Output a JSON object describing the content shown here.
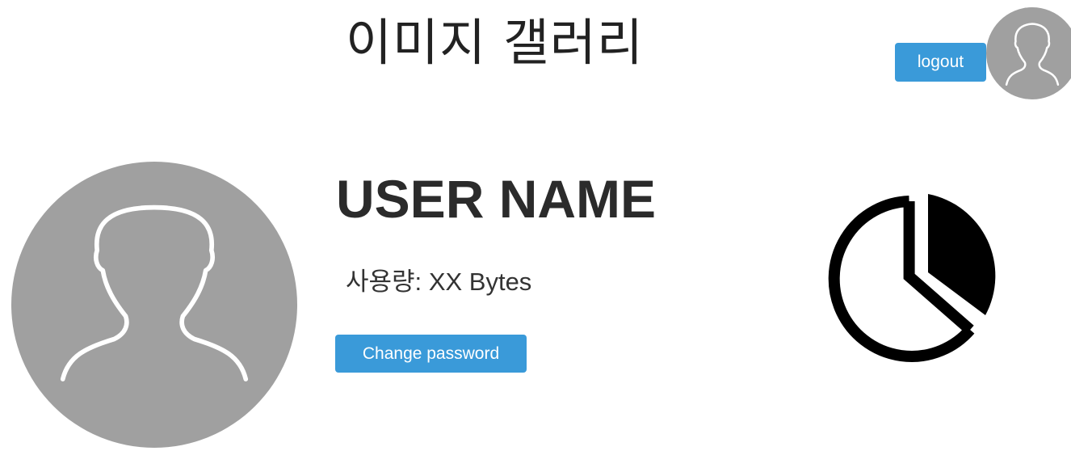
{
  "header": {
    "title": "이미지 갤러리",
    "logout_label": "logout"
  },
  "profile": {
    "user_name": "USER NAME",
    "usage_label": "사용량:",
    "usage_value": "XX Bytes",
    "change_password_label": "Change password"
  },
  "icons": {
    "header_avatar": "user-avatar-icon",
    "profile_avatar": "user-avatar-icon",
    "usage_chart": "pie-chart-icon"
  },
  "colors": {
    "button_bg": "#3a9ad9",
    "avatar_bg": "#a0a0a0",
    "avatar_outline": "#ffffff",
    "chart_icon": "#000000"
  }
}
